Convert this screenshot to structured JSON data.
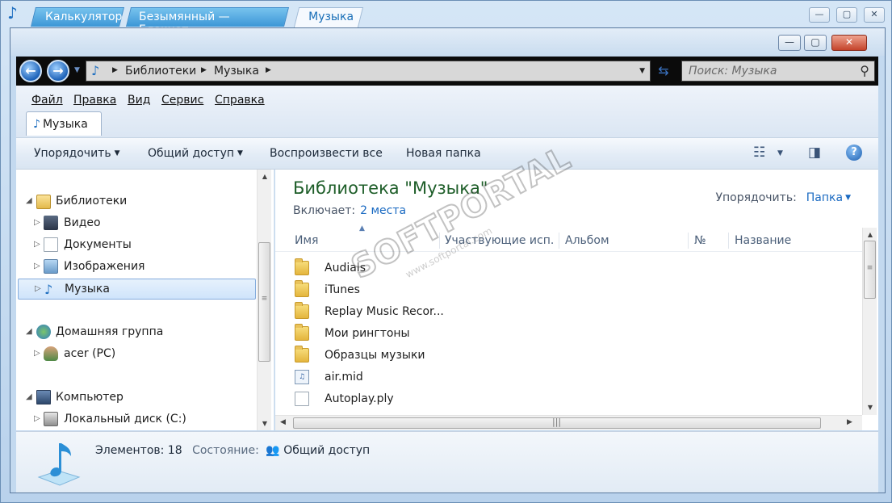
{
  "outer_tabs": [
    "Калькулятор",
    "Безымянный — Блокнот",
    "Музыка"
  ],
  "outer_active_tab": 2,
  "address": {
    "crumbs": [
      "Библиотеки",
      "Музыка"
    ],
    "search_placeholder": "Поиск: Музыка"
  },
  "menu": [
    "Файл",
    "Правка",
    "Вид",
    "Сервис",
    "Справка"
  ],
  "inner_tab": "Музыка",
  "toolbar": {
    "organize": "Упорядочить",
    "share": "Общий доступ",
    "play_all": "Воспроизвести все",
    "new_folder": "Новая папка"
  },
  "nav": {
    "libraries": "Библиотеки",
    "video": "Видео",
    "documents": "Документы",
    "images": "Изображения",
    "music": "Музыка",
    "homegroup": "Домашняя группа",
    "acer": "acer (PC)",
    "computer": "Компьютер",
    "local_disk": "Локальный диск (C:)"
  },
  "content": {
    "title": "Библиотека \"Музыка\"",
    "includes_label": "Включает:",
    "includes_link": "2 места",
    "arrange_label": "Упорядочить:",
    "arrange_value": "Папка",
    "columns": [
      "Имя",
      "Участвующие исп...",
      "Альбом",
      "№",
      "Название"
    ],
    "files": [
      {
        "name": "Audials",
        "type": "folder"
      },
      {
        "name": "iTunes",
        "type": "folder"
      },
      {
        "name": "Replay Music Recor...",
        "type": "folder"
      },
      {
        "name": "Мои рингтоны",
        "type": "folder"
      },
      {
        "name": "Образцы музыки",
        "type": "folder"
      },
      {
        "name": "air.mid",
        "type": "midi"
      },
      {
        "name": "Autoplay.ply",
        "type": "document"
      }
    ]
  },
  "details": {
    "count": "Элементов: 18",
    "state_label": "Состояние:",
    "state_value": "Общий доступ"
  },
  "watermark": {
    "main": "SOFTPORTAL",
    "sub": "www.softportal.com"
  }
}
